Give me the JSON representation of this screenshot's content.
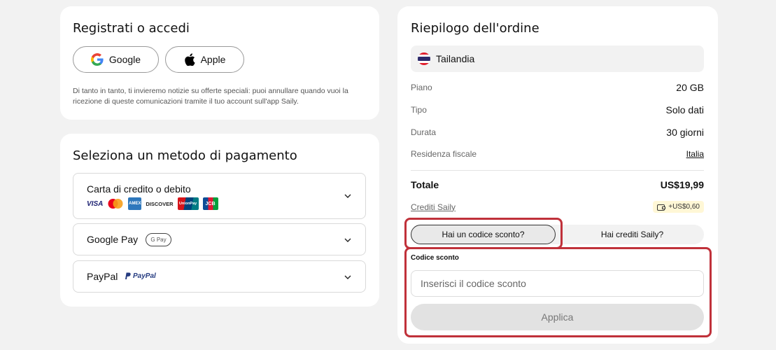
{
  "login": {
    "title": "Registrati o accedi",
    "google_label": "Google",
    "apple_label": "Apple",
    "notice": "Di tanto in tanto, ti invieremo notizie su offerte speciali: puoi annullare quando vuoi la ricezione di queste comunicazioni tramite il tuo account sull'app Saily."
  },
  "payment": {
    "title": "Seleziona un metodo di pagamento",
    "methods": [
      {
        "label": "Carta di credito o debito",
        "logos": [
          "VISA",
          "Mastercard",
          "AMEX",
          "DISCOVER",
          "UnionPay",
          "JCB"
        ]
      },
      {
        "label": "Google Pay",
        "badge": "G Pay"
      },
      {
        "label": "PayPal",
        "badge": "PayPal"
      }
    ]
  },
  "summary": {
    "title": "Riepilogo dell'ordine",
    "country": "Tailandia",
    "rows": [
      {
        "key": "Piano",
        "value": "20 GB"
      },
      {
        "key": "Tipo",
        "value": "Solo dati"
      },
      {
        "key": "Durata",
        "value": "30 giorni"
      },
      {
        "key": "Residenza fiscale",
        "value": "Italia"
      }
    ],
    "total_label": "Totale",
    "total_value": "US$19,99",
    "credits_label": "Crediti Saily",
    "credits_value": "+US$0,60",
    "toggle": {
      "discount": "Hai un codice sconto?",
      "credits": "Hai crediti Saily?"
    },
    "code_label": "Codice sconto",
    "code_placeholder": "Inserisci il codice sconto",
    "code_value": "",
    "apply_label": "Applica"
  },
  "colors": {
    "highlight": "#c0313a",
    "background": "#f2f2f2",
    "credit_badge": "#fff7d6"
  }
}
